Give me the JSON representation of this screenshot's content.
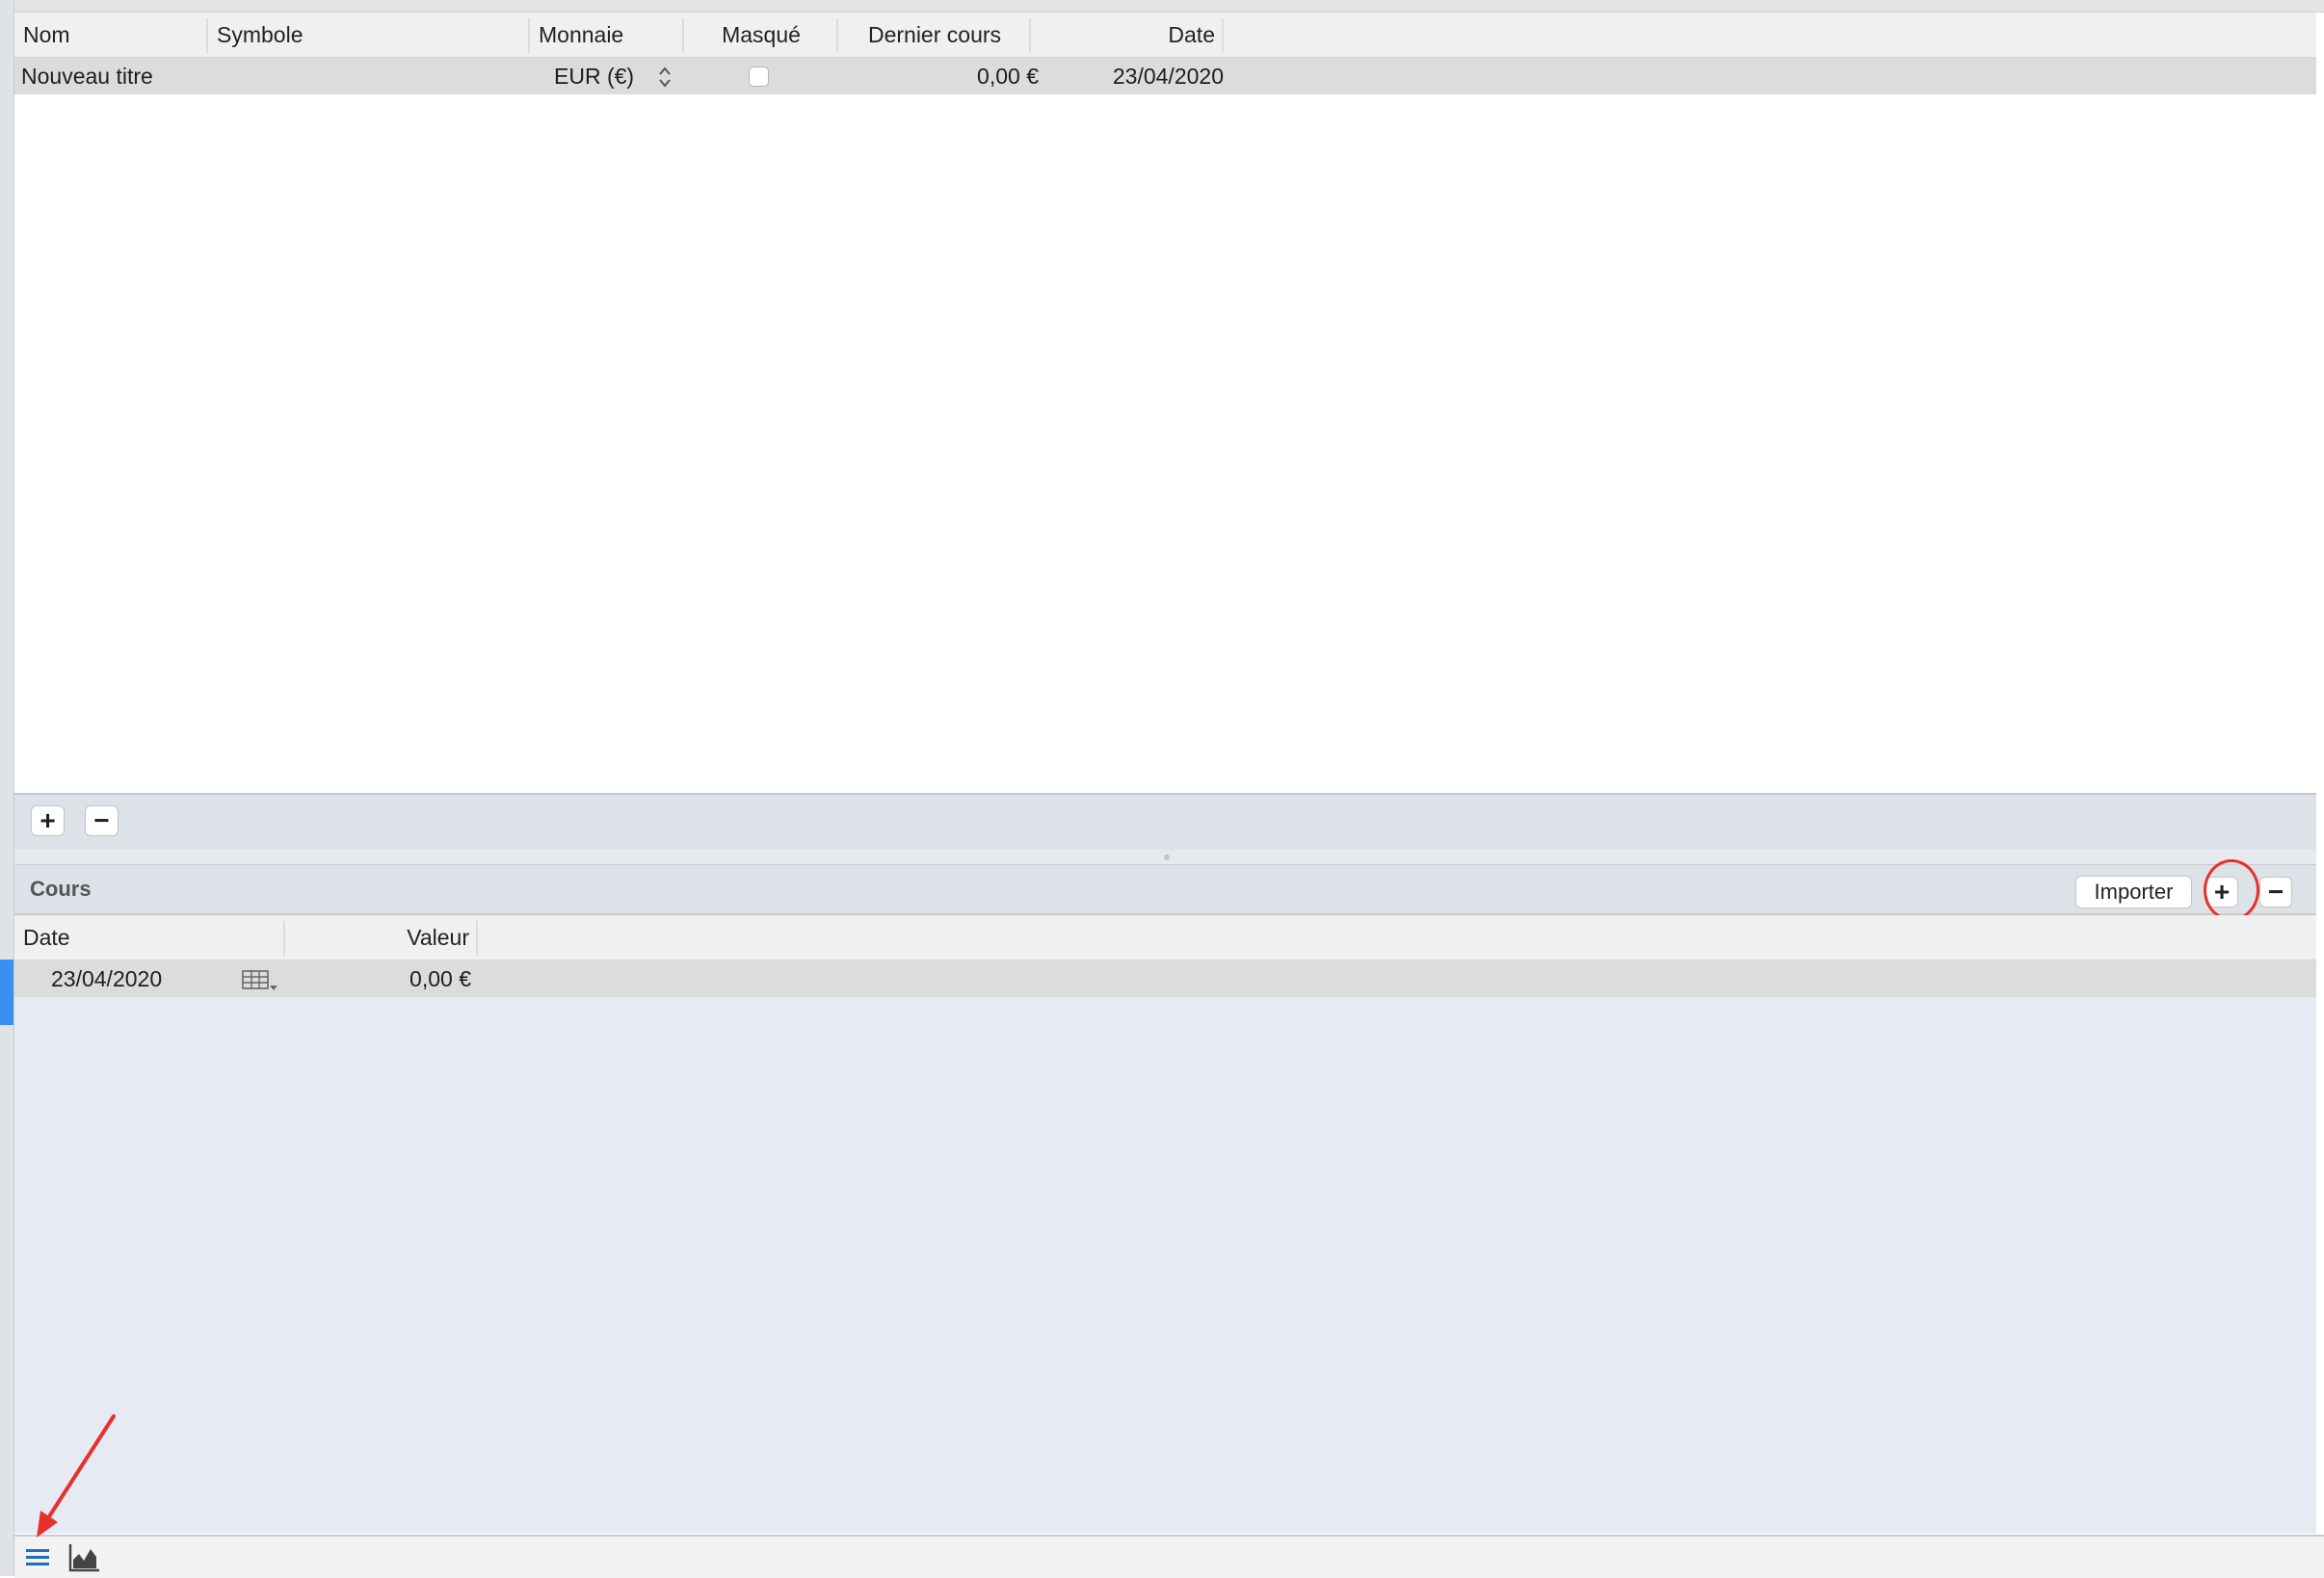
{
  "securities_table": {
    "columns": [
      "Nom",
      "Symbole",
      "Monnaie",
      "Masqué",
      "Dernier cours",
      "Date"
    ],
    "rows": [
      {
        "name": "Nouveau titre",
        "symbol": "",
        "currency": "EUR (€)",
        "hidden": false,
        "last_price": "0,00 €",
        "date": "23/04/2020"
      }
    ]
  },
  "securities_toolbar": {
    "add_label": "+",
    "remove_label": "−"
  },
  "prices_panel": {
    "title": "Cours",
    "import_label": "Importer",
    "add_label": "+",
    "remove_label": "−"
  },
  "prices_table": {
    "columns": [
      "Date",
      "Valeur"
    ],
    "rows": [
      {
        "date": "23/04/2020",
        "value": "0,00 €"
      }
    ]
  },
  "bottom_tabs": [
    {
      "icon": "list-icon",
      "active": true
    },
    {
      "icon": "chart-icon",
      "active": false
    }
  ],
  "colors": {
    "accent": "#3b8ff2",
    "annotation": "#e8302a",
    "active_tab": "#1f6fb5"
  }
}
